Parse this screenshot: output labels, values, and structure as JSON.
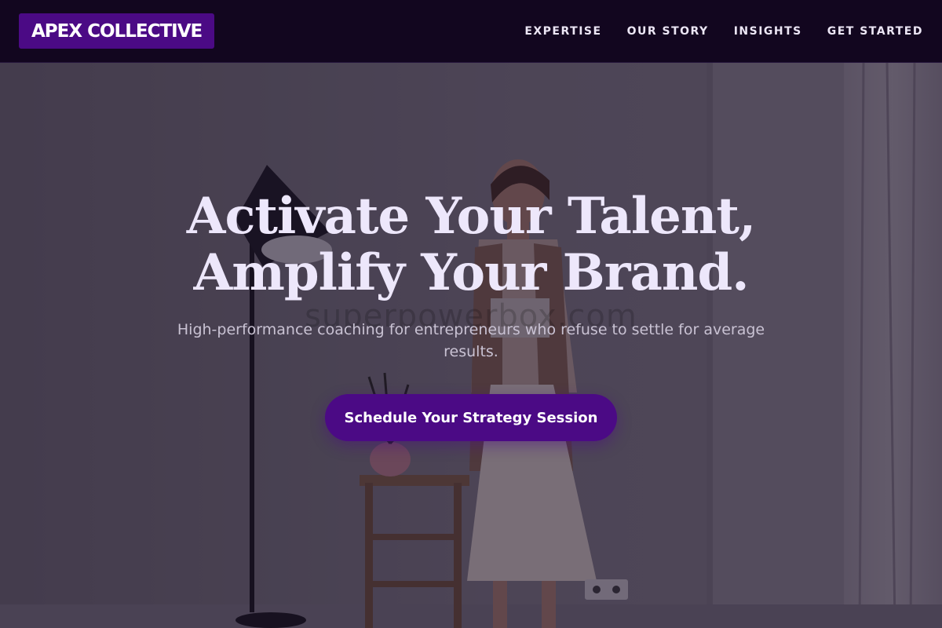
{
  "brand": {
    "name": "APEX COLLECTIVE"
  },
  "nav": {
    "items": [
      {
        "label": "EXPERTISE"
      },
      {
        "label": "OUR STORY"
      },
      {
        "label": "INSIGHTS"
      },
      {
        "label": "GET STARTED"
      }
    ]
  },
  "hero": {
    "headline_line1": "Activate Your Talent,",
    "headline_line2": "Amplify Your Brand.",
    "subtitle": "High-performance coaching for entrepreneurs who refuse to settle for average results.",
    "cta_label": "Schedule Your Strategy Session",
    "watermark": "superpowerbox.com"
  },
  "colors": {
    "nav_bg": "#12061f",
    "brand_bg": "#4b0a85",
    "accent": "#4b0a85",
    "headline": "#ede7fb"
  }
}
